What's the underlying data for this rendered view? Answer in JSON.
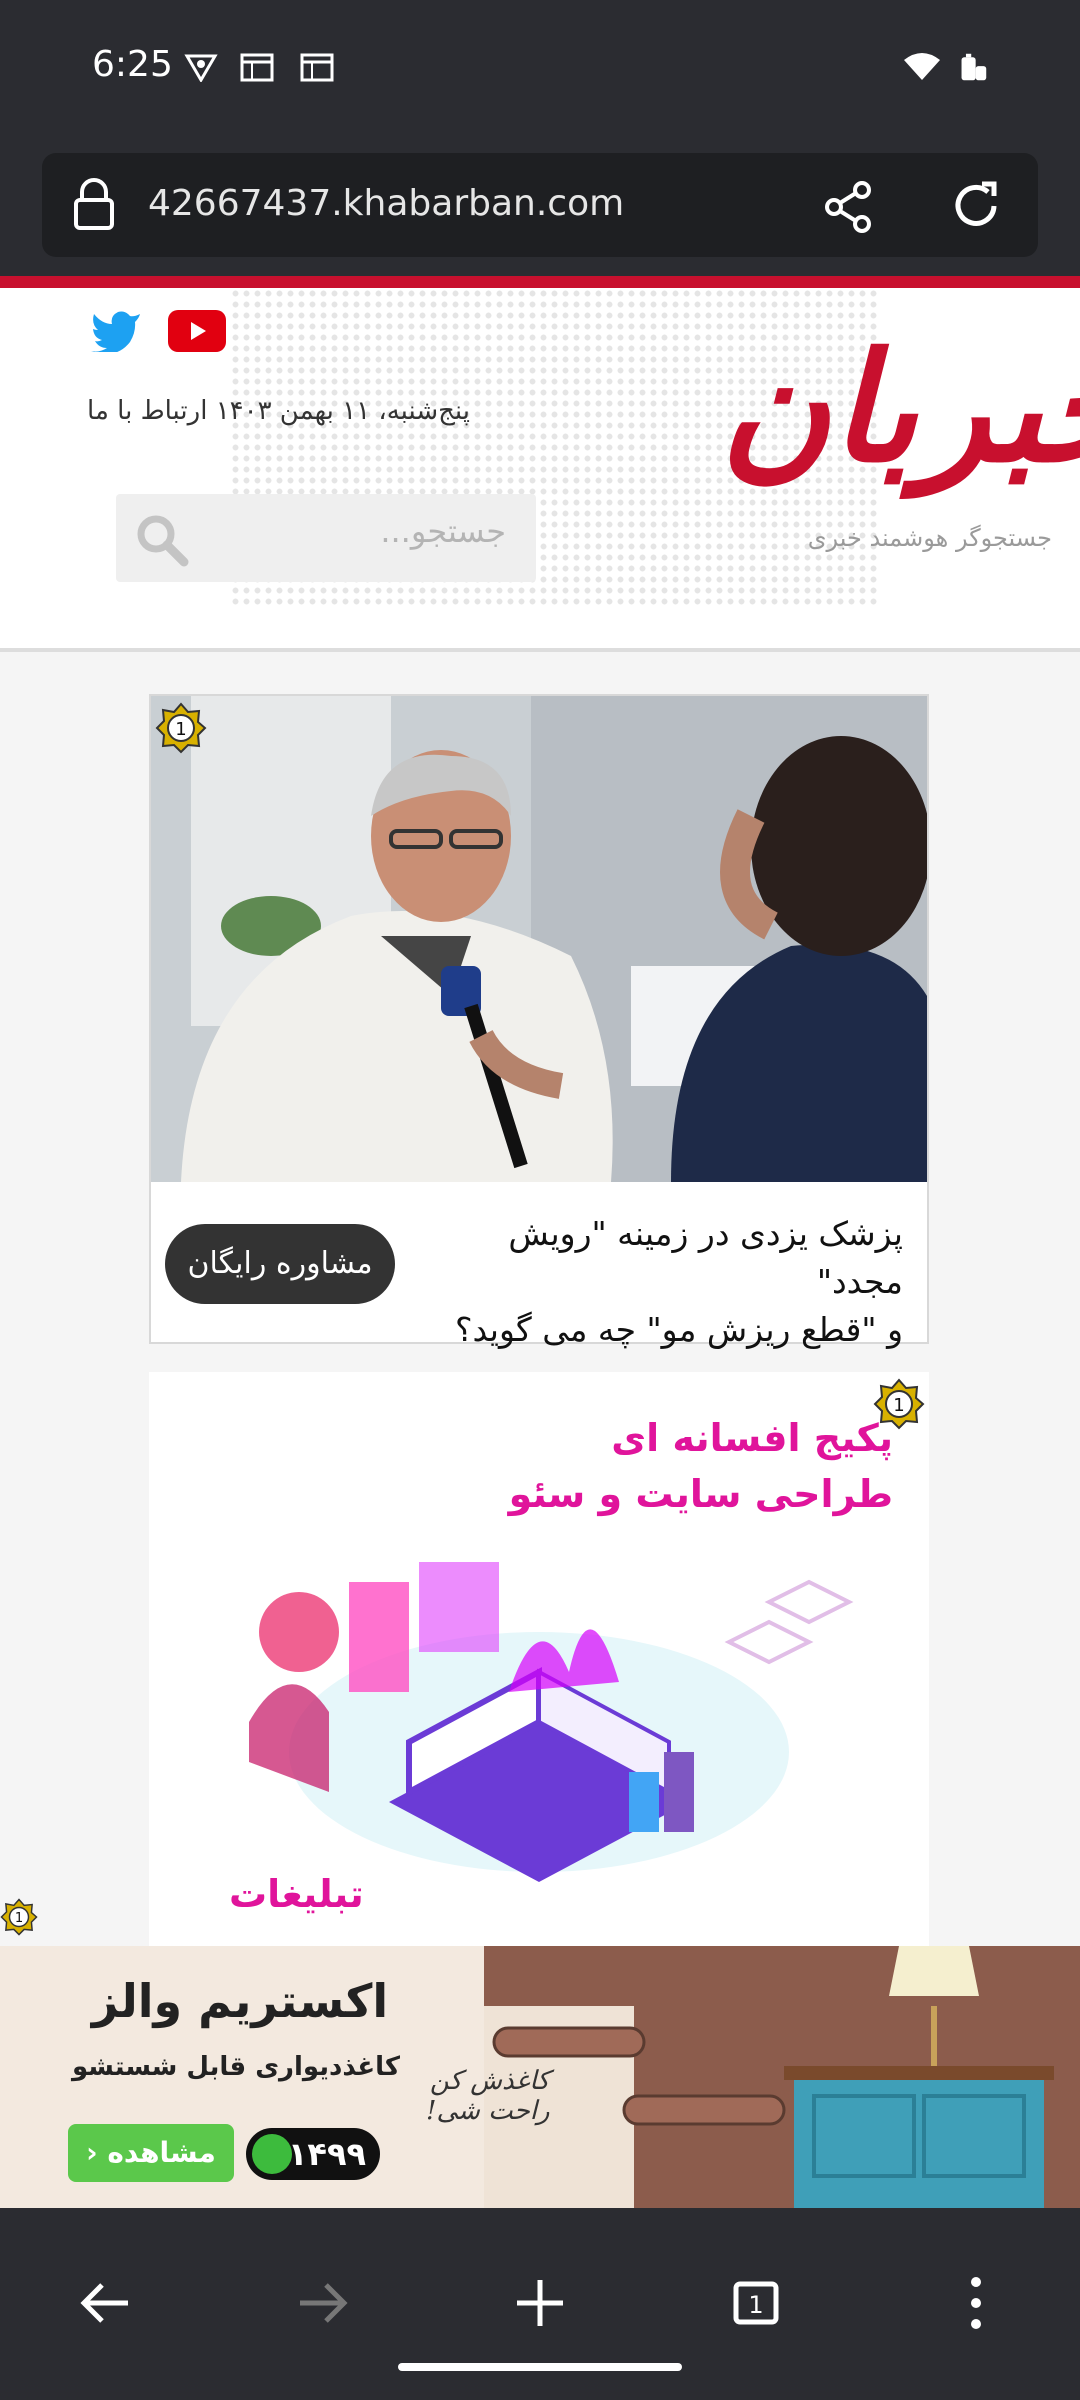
{
  "status_bar": {
    "time": "6:25",
    "icons": [
      "vpn-key-icon",
      "calendar-icon",
      "calendar-icon",
      "wifi-icon",
      "battery-icon"
    ]
  },
  "browser": {
    "url": "42667437.khabarban.com",
    "icons": [
      "lock-icon",
      "share-icon",
      "reload-icon"
    ]
  },
  "site_header": {
    "date_text": "پنج‌شنبه، ۱۱ بهمن ۱۴۰۳  ارتباط با ما",
    "search_placeholder": "جستجو...",
    "logo": "خبربان",
    "tagline": "جستجوگر هوشمند خبری",
    "social": [
      "twitter-icon",
      "youtube-icon"
    ]
  },
  "ad_card_1": {
    "badge": "1",
    "headline_line1": "پزشک یزدی در زمینه \"رویش مجدد\"",
    "headline_line2": "و \"قطع ریزش مو\" چه می گوید؟",
    "cta_label": "مشاوره رایگان"
  },
  "ad_card_2": {
    "badge": "1",
    "title_line1": "پکیج افسانه ای",
    "title_line2": "طراحی سایت و سئو",
    "footer_text": "تبلیغات"
  },
  "bottom_banner": {
    "badge": "1",
    "brand": "اکستریم والز",
    "subtitle": "کاغذدیواری قابل شستشو",
    "phone": "۱۴۹۹",
    "view_label": "مشاهده",
    "script_line1": "کاغذش کن",
    "script_line2": "راحت شی!"
  },
  "nav_bar": {
    "tab_count": "1",
    "icons": [
      "back-icon",
      "forward-icon",
      "new-tab-icon",
      "tabs-icon",
      "menu-icon"
    ]
  },
  "colors": {
    "brand_red": "#c8102e",
    "chrome_dark": "#2b2c31",
    "ad_magenta": "#e0149b",
    "cta_green": "#5bc84b"
  }
}
